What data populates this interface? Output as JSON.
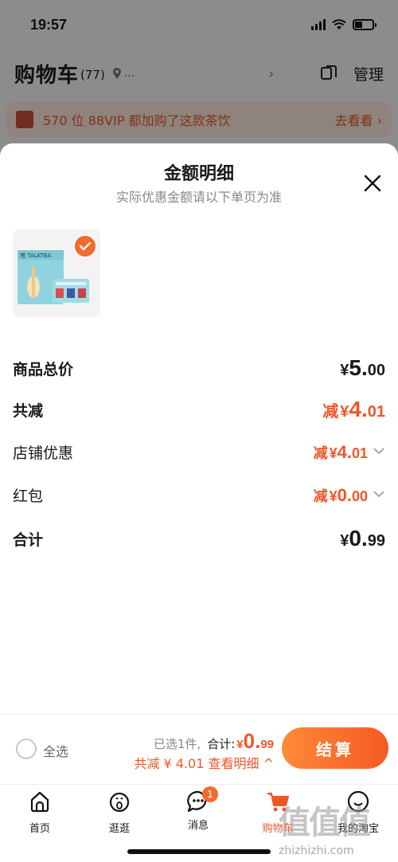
{
  "status_bar": {
    "time": "19:57"
  },
  "header": {
    "title": "购物车",
    "count": "(77)",
    "location": "...",
    "manage": "管理"
  },
  "promo": {
    "text": "570 位 88VIP 都加购了这款茶饮",
    "action": "去看看 ›"
  },
  "sheet": {
    "title": "金额明细",
    "subtitle": "实际优惠金额请以下单页为准",
    "product": {
      "brand_text": "塔 TALKTEA"
    },
    "rows": [
      {
        "label": "商品总价",
        "prefix": "",
        "currency": "¥",
        "int": "5.",
        "dec": "00"
      },
      {
        "label": "共减",
        "prefix": "减",
        "currency": "¥",
        "int": "4.",
        "dec": "01"
      },
      {
        "label": "店铺优惠",
        "prefix": "减",
        "currency": "¥",
        "int": "4.",
        "dec": "01"
      },
      {
        "label": "红包",
        "prefix": "减",
        "currency": "¥",
        "int": "0.",
        "dec": "00"
      },
      {
        "label": "合计",
        "prefix": "",
        "currency": "¥",
        "int": "0.",
        "dec": "99"
      }
    ]
  },
  "summary": {
    "select_all": "全选",
    "selected": "已选1件,",
    "total_label": "合计:",
    "total_currency": "¥",
    "total_int": "0.",
    "total_dec": "99",
    "discount": "共减 ¥ 4.01 查看明细 ^",
    "checkout": "结算"
  },
  "tabs": [
    {
      "label": "首页",
      "icon": "home-icon"
    },
    {
      "label": "逛逛",
      "icon": "explore-icon"
    },
    {
      "label": "消息",
      "icon": "message-icon",
      "badge": "1"
    },
    {
      "label": "购物车",
      "icon": "cart-icon",
      "active": true
    },
    {
      "label": "我的淘宝",
      "icon": "profile-icon"
    }
  ],
  "watermark": {
    "glyphs": "值值值",
    "url": "zhizhizhi.com"
  },
  "colors": {
    "accent": "#f0562a",
    "sheet_bg": "#ffffff"
  }
}
